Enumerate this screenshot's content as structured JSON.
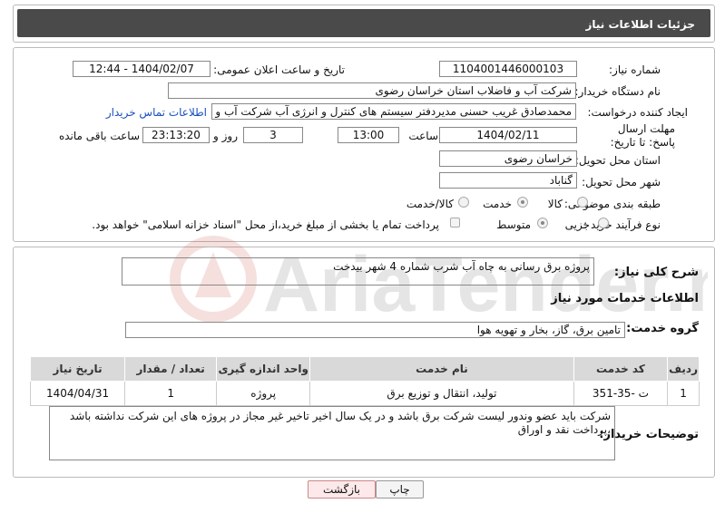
{
  "header": {
    "title": "جزئیات اطلاعات نیاز"
  },
  "form": {
    "need_number_label": "شماره نیاز:",
    "need_number": "1104001446000103",
    "announce_label": "تاریخ و ساعت اعلان عمومی:",
    "announce_value": "1404/02/07 - 12:44",
    "buyer_label": "نام دستگاه خریدار:",
    "buyer_value": "شرکت آب و فاضلاب استان خراسان رضوی",
    "creator_label": "ایجاد کننده درخواست:",
    "creator_value": "محمدصادق غریب حسنی مدیردفتر سیستم های کنترل و انرژی آب شرکت آب و",
    "contact_link": "اطلاعات تماس خریدار",
    "deadline_label": "مهلت ارسال پاسخ: تا تاریخ:",
    "deadline_date": "1404/02/11",
    "hour_label": "ساعت",
    "deadline_hour": "13:00",
    "days_value": "3",
    "days_label": "روز و",
    "remaining_time": "23:13:20",
    "remaining_label": "ساعت باقی مانده",
    "province_label": "استان محل تحویل:",
    "province_value": "خراسان رضوی",
    "city_label": "شهر محل تحویل:",
    "city_value": "گناباد",
    "category_label": "طبقه بندی موضوعی:",
    "category_options": [
      "کالا",
      "خدمت",
      "کالا/خدمت"
    ],
    "category_selected": "خدمت",
    "process_label": "نوع فرآیند خرید :",
    "process_options": [
      "جزیی",
      "متوسط"
    ],
    "process_selected": "متوسط",
    "payment_note": "پرداخت تمام یا بخشی از مبلغ خرید،از محل \"اسناد خزانه اسلامی\" خواهد بود."
  },
  "summary": {
    "label": "شرح کلی نیاز:",
    "value": "پروژه برق رسانی به  چاه آب شرب  شماره 4   شهر بیدخت"
  },
  "services": {
    "section_title": "اطلاعات خدمات مورد نیاز",
    "group_label": "گروه خدمت:",
    "group_value": "تامین برق، گاز، بخار و تهویه هوا",
    "table": {
      "headers": [
        "ردیف",
        "کد خدمت",
        "نام خدمت",
        "واحد اندازه گیری",
        "تعداد / مقدار",
        "تاریخ نیاز"
      ],
      "rows": [
        [
          "1",
          "ت -35-351",
          "تولید، انتقال و توزیع برق",
          "پروژه",
          "1",
          "1404/04/31"
        ]
      ]
    }
  },
  "notes": {
    "label": "توضیحات خریدار:",
    "value": "شرکت باید عضو وندور لیست شرکت برق باشد و در یک سال اخیر تاخیر غیر مجاز در پروژه های این شرکت نداشته باشد ،پرداخت نقد و اوراق"
  },
  "buttons": {
    "print": "چاپ",
    "back": "بازگشت"
  },
  "watermark": "AriaTender.neT"
}
